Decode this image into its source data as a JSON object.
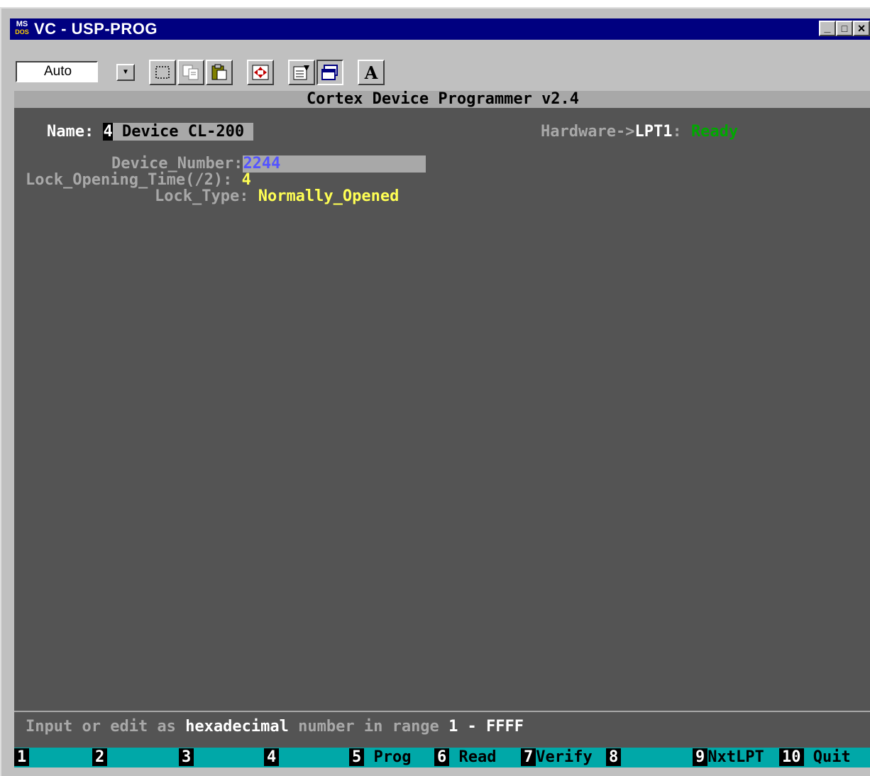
{
  "window": {
    "app_icon_top": "MS",
    "app_icon_bottom": "DOS",
    "title": "VC - USP-PROG",
    "min_glyph": "_",
    "max_glyph": "□",
    "close_glyph": "×"
  },
  "toolbar": {
    "font_size_value": "Auto",
    "buttons": [
      "mark-icon",
      "copy-icon",
      "paste-icon",
      "fullscreen-icon",
      "properties-icon",
      "background-icon",
      "font-icon"
    ],
    "font_glyph": "A"
  },
  "console": {
    "header": "Cortex Device Programmer v2.4",
    "name_label": "Name:",
    "name_index": "4",
    "name_value": " Device CL-200 ",
    "hardware_label": "Hardware->",
    "hardware_port": "LPT1",
    "hardware_colon": ":",
    "hardware_status": "Ready",
    "device_number_label": "Device_Number:",
    "device_number_value": "2244",
    "lock_time_label": "Lock_Opening_Time(/2):",
    "lock_time_value": "4",
    "lock_type_label": "Lock_Type:",
    "lock_type_value": "Normally_Opened",
    "hint_part1": "Input or edit as",
    "hint_bold": "hexadecimal",
    "hint_part2": "number in range",
    "hint_range": "1 - FFFF"
  },
  "fkeys": [
    {
      "num": "1",
      "label": ""
    },
    {
      "num": "2",
      "label": ""
    },
    {
      "num": "3",
      "label": ""
    },
    {
      "num": "4",
      "label": ""
    },
    {
      "num": "5",
      "label": "Prog"
    },
    {
      "num": "6",
      "label": "Read"
    },
    {
      "num": "7",
      "label": "Verify"
    },
    {
      "num": "8",
      "label": ""
    },
    {
      "num": "9",
      "label": "NxtLPT"
    },
    {
      "num": "10",
      "label": "Quit"
    }
  ],
  "colors": {
    "title_bar": "#000080",
    "console_bg": "#545454",
    "fkey_bar": "#00a8a8",
    "ready": "#00a800",
    "value_yellow": "#ffff54",
    "value_blue": "#5454ff"
  }
}
